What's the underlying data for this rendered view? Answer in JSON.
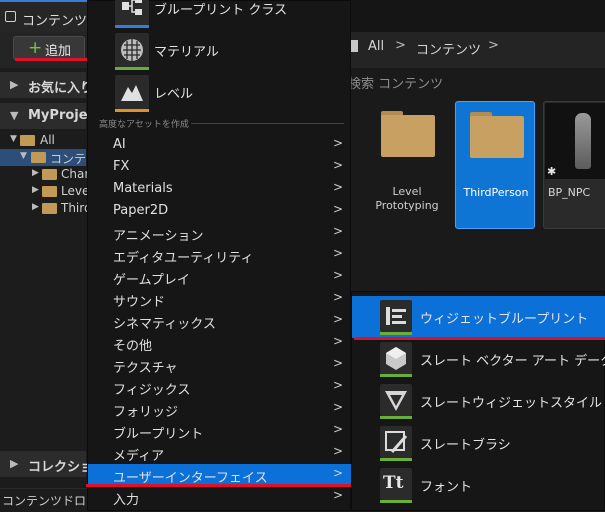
{
  "tab": {
    "title": "コンテンツ"
  },
  "toolbar": {
    "add_plus": "+",
    "add_label": "追加"
  },
  "breadcrumb": {
    "items": [
      "All",
      "コンテンツ"
    ],
    "separator": ">"
  },
  "left_panel": {
    "favorites_label": "お気に入り",
    "project_label": "MyProject",
    "tree": [
      {
        "label": "All",
        "level": 0,
        "expanded": true
      },
      {
        "label": "コンテンツ",
        "level": 1,
        "expanded": true,
        "selected": true
      },
      {
        "label": "Characters",
        "level": 2
      },
      {
        "label": "LevelPrototyping",
        "level": 2
      },
      {
        "label": "ThirdPerson",
        "level": 2
      }
    ],
    "collections_label": "コレクション"
  },
  "status_bar": {
    "text": "コンテンツドロワー"
  },
  "search": {
    "placeholder": "検索 コンテンツ"
  },
  "assets": [
    {
      "label": "Level Prototyping",
      "type": "folder"
    },
    {
      "label": "ThirdPerson",
      "type": "folder",
      "selected": true
    },
    {
      "label": "BP_NPC",
      "type": "blueprint"
    }
  ],
  "menu": {
    "top_items": [
      {
        "label": "ブループリント クラス",
        "icon": "blueprint-class-icon",
        "bar_color": "#2f7fe0"
      },
      {
        "label": "マテリアル",
        "icon": "material-icon",
        "bar_color": "#6aae3a"
      },
      {
        "label": "レベル",
        "icon": "level-icon",
        "bar_color": "#e0912b"
      }
    ],
    "advanced_heading": "高度なアセットを作成",
    "items": [
      {
        "label": "AI",
        "arrow": ">"
      },
      {
        "label": "FX",
        "arrow": ">"
      },
      {
        "label": "Materials",
        "arrow": ">"
      },
      {
        "label": "Paper2D",
        "arrow": ">"
      },
      {
        "label": "アニメーション",
        "arrow": ">"
      },
      {
        "label": "エディタユーティリティ",
        "arrow": ">"
      },
      {
        "label": "ゲームプレイ",
        "arrow": ">"
      },
      {
        "label": "サウンド",
        "arrow": ">"
      },
      {
        "label": "シネマティックス",
        "arrow": ">"
      },
      {
        "label": "その他",
        "arrow": ">"
      },
      {
        "label": "テクスチャ",
        "arrow": ">"
      },
      {
        "label": "フィジックス",
        "arrow": ">"
      },
      {
        "label": "フォリッジ",
        "arrow": ">"
      },
      {
        "label": "ブループリント",
        "arrow": ">"
      },
      {
        "label": "メディア",
        "arrow": ">"
      },
      {
        "label": "ユーザーインターフェイス",
        "arrow": ">",
        "selected": true
      },
      {
        "label": "入力",
        "arrow": ">"
      }
    ]
  },
  "submenu": {
    "items": [
      {
        "label": "ウィジェットブループリント",
        "icon": "widget-blueprint-icon",
        "selected": true
      },
      {
        "label": "スレート ベクター アート データ",
        "icon": "slate-vector-icon"
      },
      {
        "label": "スレートウィジェットスタイル",
        "icon": "slate-widget-style-icon"
      },
      {
        "label": "スレートブラシ",
        "icon": "slate-brush-icon"
      },
      {
        "label": "フォント",
        "icon": "font-icon",
        "glyph": "Tt"
      }
    ]
  },
  "colors": {
    "accent_blue": "#0b70d8",
    "highlight_red": "#e0102a",
    "add_green": "#6fcb3a",
    "folder": "#c8a061"
  }
}
